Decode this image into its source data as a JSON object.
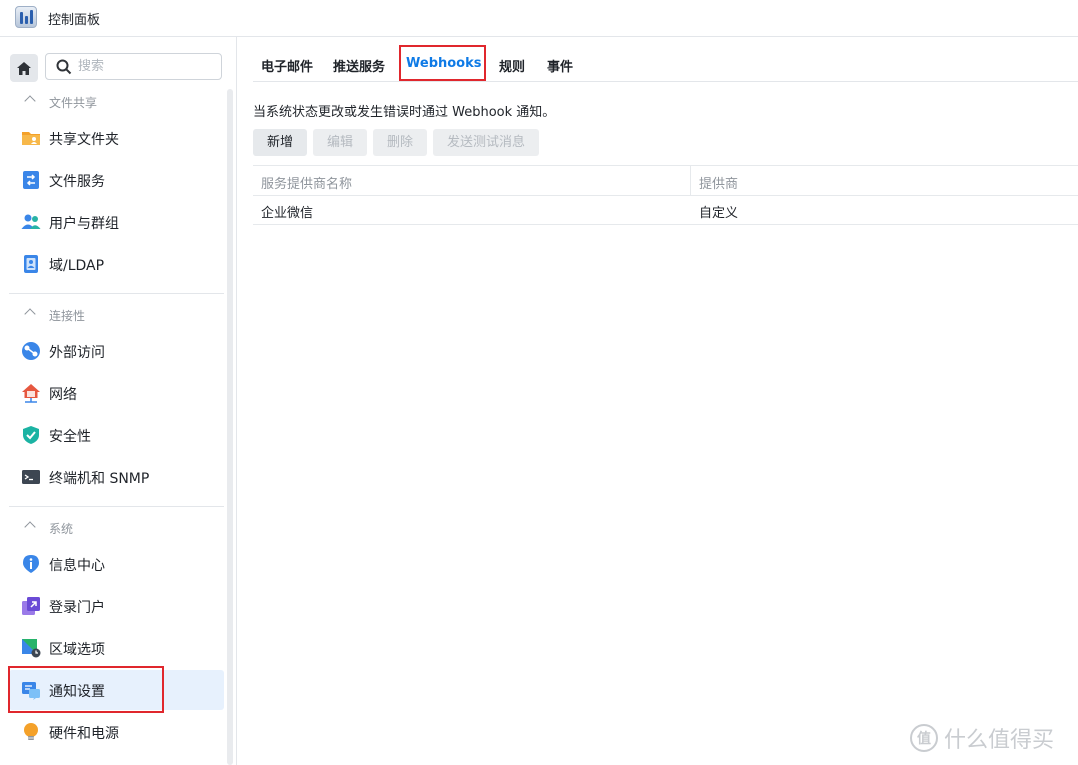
{
  "window": {
    "title": "控制面板"
  },
  "sidebar": {
    "search_placeholder": "搜索",
    "groups": [
      {
        "label": "文件共享",
        "items": [
          {
            "label": "共享文件夹",
            "icon": "shared-folder-icon"
          },
          {
            "label": "文件服务",
            "icon": "file-services-icon"
          },
          {
            "label": "用户与群组",
            "icon": "users-groups-icon"
          },
          {
            "label": "域/LDAP",
            "icon": "domain-ldap-icon"
          }
        ]
      },
      {
        "label": "连接性",
        "items": [
          {
            "label": "外部访问",
            "icon": "external-access-icon"
          },
          {
            "label": "网络",
            "icon": "network-icon"
          },
          {
            "label": "安全性",
            "icon": "security-shield-icon"
          },
          {
            "label": "终端机和 SNMP",
            "icon": "terminal-icon"
          }
        ]
      },
      {
        "label": "系统",
        "items": [
          {
            "label": "信息中心",
            "icon": "info-center-icon"
          },
          {
            "label": "登录门户",
            "icon": "login-portal-icon"
          },
          {
            "label": "区域选项",
            "icon": "regional-options-icon"
          },
          {
            "label": "通知设置",
            "icon": "notification-icon",
            "active": true
          },
          {
            "label": "硬件和电源",
            "icon": "hardware-power-icon"
          }
        ]
      }
    ]
  },
  "tabs": [
    {
      "label": "电子邮件"
    },
    {
      "label": "推送服务"
    },
    {
      "label": "Webhooks",
      "active": true
    },
    {
      "label": "规则"
    },
    {
      "label": "事件"
    }
  ],
  "description": "当系统状态更改或发生错误时通过 Webhook 通知。",
  "toolbar": {
    "add": "新增",
    "edit": "编辑",
    "delete": "删除",
    "send_test": "发送测试消息"
  },
  "table": {
    "columns": [
      "服务提供商名称",
      "提供商"
    ],
    "rows": [
      [
        "企业微信",
        "自定义"
      ]
    ]
  },
  "watermark": {
    "text": "什么值得买",
    "mark": "值"
  },
  "colors": {
    "accent": "#0e7ae6",
    "highlight_border": "#e0272d",
    "active_bg": "#e7f1fd"
  }
}
